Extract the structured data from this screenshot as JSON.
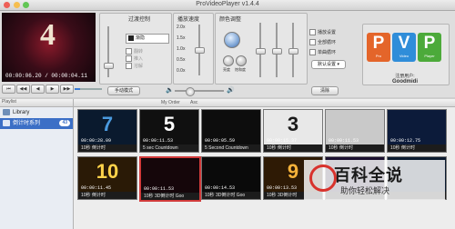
{
  "window": {
    "title": "ProVideoPlayer v1.4.4"
  },
  "player": {
    "timecode": "00:00:06.20 / 00:00:04.11",
    "big_number": "4",
    "progress_fraction": 0.2,
    "transport": [
      "⏮",
      "◀◀",
      "◀",
      "▶",
      "▶▶"
    ]
  },
  "panels": {
    "transition": "过渡控制",
    "playback_speed": "播放速度",
    "color_adjust": "颜色调整",
    "speed_ticks": [
      "2.0x",
      "1.5x",
      "1.0x",
      "0.5x",
      "0.0x"
    ],
    "color_labels": [
      "亮度",
      "饱和度",
      "对比度"
    ]
  },
  "transition_options": [
    "渐隐",
    "翻转",
    "推入",
    "溶解"
  ],
  "checkboxes": [
    "播放设置",
    "全部循环",
    "单曲循环"
  ],
  "dropdown": {
    "value": "默认设置"
  },
  "buttons": {
    "manual_mode": "手动模式",
    "clear": "清除"
  },
  "brand": {
    "letters": [
      "P",
      "V",
      "P"
    ],
    "subs": [
      "Pro",
      "Video",
      "Player"
    ],
    "colors": [
      "#e4652a",
      "#2f8dd9",
      "#4caa3a"
    ],
    "registered_label": "注册用户:",
    "user": "Goodmidi"
  },
  "library_header": "Playlist",
  "sidebar": {
    "items": [
      {
        "label": "Library",
        "count": ""
      },
      {
        "label": "倒计时系列",
        "count": "43"
      }
    ]
  },
  "grid_header": {
    "sort": "My Order",
    "dir": "Asc"
  },
  "thumbs": [
    {
      "num": "7",
      "tc": "00:00:28.09",
      "cap": "10秒 倒计时",
      "color": "#4a9adf",
      "bg": "#0a1a2e"
    },
    {
      "num": "5",
      "tc": "00:00:11.53",
      "cap": "5 sec Countdown",
      "color": "#ffffff",
      "bg": "#101010"
    },
    {
      "num": "",
      "tc": "00:00:05.59",
      "cap": "5 Second Countdown",
      "color": "#ffffff",
      "bg": "#0d0d0d"
    },
    {
      "num": "3",
      "tc": "00:00:15.37",
      "cap": "10秒 倒计时",
      "color": "#1a1a1a",
      "bg": "#e8e8e8"
    },
    {
      "num": "",
      "tc": "00:00:11.53",
      "cap": "10秒 倒计时",
      "color": "#222",
      "bg": "#c9c9c9"
    },
    {
      "num": "",
      "tc": "00:00:12.75",
      "cap": "10秒 倒计时",
      "color": "#fff",
      "bg": "#0c1b3a"
    },
    {
      "num": "10",
      "tc": "00:00:11.45",
      "cap": "10秒 倒计时",
      "color": "#ffd34a",
      "bg": "#2a1a06"
    },
    {
      "num": "",
      "tc": "00:00:11.53",
      "cap": "10秒 3D倒计时 Goo",
      "color": "#fff",
      "bg": "#15060a"
    },
    {
      "num": "",
      "tc": "00:00:14.53",
      "cap": "10秒 3D倒计时 Goo",
      "color": "#fff",
      "bg": "#0a0a0a"
    },
    {
      "num": "9",
      "tc": "00:00:13.53",
      "cap": "10秒 3D倒计时",
      "color": "#f5b23a",
      "bg": "#2e1a05"
    },
    {
      "num": "",
      "tc": "",
      "cap": "",
      "color": "#fff",
      "bg": "#1a0f2e"
    },
    {
      "num": "",
      "tc": "",
      "cap": "",
      "color": "#fff",
      "bg": "#0a1a2e"
    }
  ],
  "watermark": {
    "line1": "百科全说",
    "line2": "助你轻松解决"
  }
}
